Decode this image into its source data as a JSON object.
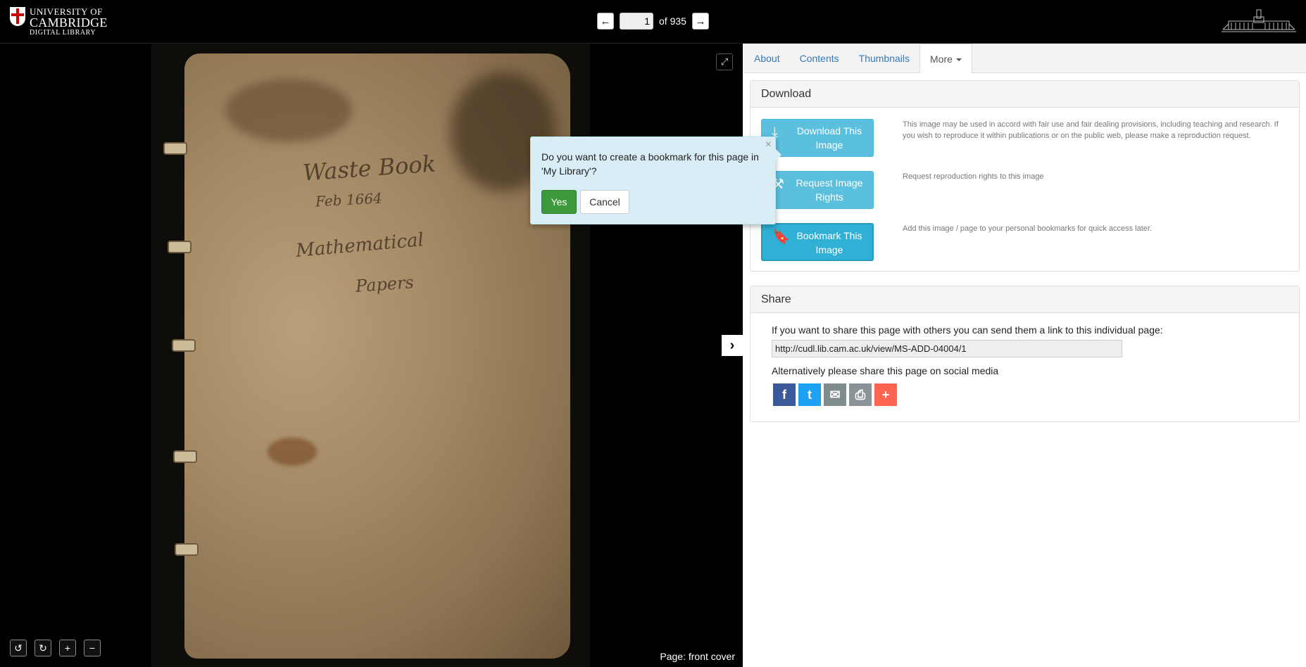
{
  "header": {
    "logo": {
      "line1": "UNIVERSITY OF",
      "line2": "CAMBRIDGE",
      "line3": "DIGITAL LIBRARY"
    },
    "pager": {
      "prev_icon": "arrow-left-icon",
      "next_icon": "arrow-right-icon",
      "current_page": "1",
      "total_text": "of 935"
    }
  },
  "viewer": {
    "page_label": "Page: front cover",
    "handwriting": {
      "line1": "Waste Book",
      "line2": "Feb 1664",
      "line3": "Mathematical",
      "line4": "Papers"
    },
    "expand_icon": "expand-icon",
    "toggle_icon": "chevron-right-icon",
    "zoom_buttons": [
      {
        "icon": "rotate-left-icon",
        "glyph": "↺"
      },
      {
        "icon": "rotate-right-icon",
        "glyph": "↻"
      },
      {
        "icon": "zoom-in-icon",
        "glyph": "+"
      },
      {
        "icon": "zoom-out-icon",
        "glyph": "−"
      }
    ]
  },
  "tabs": [
    {
      "label": "About",
      "active": false
    },
    {
      "label": "Contents",
      "active": false
    },
    {
      "label": "Thumbnails",
      "active": false
    },
    {
      "label": "More",
      "active": true
    }
  ],
  "download": {
    "heading": "Download",
    "buttons": [
      {
        "label": "Download This Image",
        "icon": "download-icon",
        "description": "This image may be used in accord with fair use and fair dealing provisions, including teaching and research. If you wish to reproduce it within publications or on the public web, please make a reproduction request."
      },
      {
        "label": "Request Image Rights",
        "icon": "gavel-icon",
        "description": "Request reproduction rights to this image"
      },
      {
        "label": "Bookmark This Image",
        "icon": "bookmark-icon",
        "description": "Add this image / page to your personal bookmarks for quick access later."
      }
    ]
  },
  "share": {
    "heading": "Share",
    "intro": "If you want to share this page with others you can send them a link to this individual page:",
    "url": "http://cudl.lib.cam.ac.uk/view/MS-ADD-04004/1",
    "social_text": "Alternatively please share this page on social media",
    "social": [
      {
        "name": "facebook-icon",
        "glyph": "f",
        "color": "#3b5998"
      },
      {
        "name": "twitter-icon",
        "glyph": "t",
        "color": "#1da1f2"
      },
      {
        "name": "email-icon",
        "glyph": "✉",
        "color": "#7f8c8d"
      },
      {
        "name": "print-icon",
        "glyph": "⎙",
        "color": "#8a9498"
      },
      {
        "name": "add-share-icon",
        "glyph": "+",
        "color": "#ff6550"
      }
    ]
  },
  "popover": {
    "close": "×",
    "text": "Do you want to create a bookmark for this page in 'My Library'?",
    "yes": "Yes",
    "cancel": "Cancel"
  },
  "colors": {
    "info_button": "#5bc0de",
    "success_button": "#3c9a3c",
    "popover_bg": "#d9edf7",
    "link": "#337ab7"
  }
}
